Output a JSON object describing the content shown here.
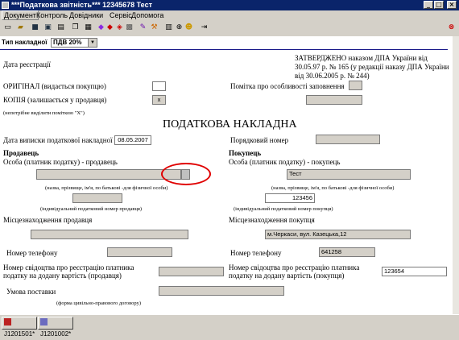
{
  "window": {
    "title": "***Податкова звітність*** 12345678 Тест"
  },
  "menu": [
    "Документ",
    "Контроль",
    "Довідники",
    "Сервіс",
    "Допомога"
  ],
  "toolbar": [
    "new-icon",
    "open-icon",
    "save-icon",
    "save-as-icon",
    "print-icon",
    "copy-icon",
    "paste-icon",
    "book-icon",
    "red-book-icon",
    "books-icon",
    "print-preview-icon",
    "edit-icon",
    "tools-icon",
    "layout-icon",
    "zoom-icon",
    "help-icon",
    "exit-icon",
    "close-icon"
  ],
  "form": {
    "type_label": "Тип накладної",
    "type_value": "ПДВ 20%",
    "approved": [
      "ЗАТВЕРДЖЕНО наказом ДПА України від",
      "30.05.97 р. № 165 (у редакції наказу ДПА України",
      "від 30.06.2005 р. № 244)"
    ],
    "reg_date_label": "Дата реєстрації",
    "original_label": "ОРИГІНАЛ (видається покупцю)",
    "copy_label": "КОПІЯ (залишається у продавця)",
    "copy_value": "x",
    "mark_note": "(непотрібне виділити поміткою \"Х\")",
    "special_label": "Помітка про особливості заповнення",
    "heading": "ПОДАТКОВА НАКЛАДНА",
    "issue_date_label": "Дата виписки податкової накладної",
    "issue_date": "08.05.2007",
    "seq_number_label": "Порядковий номер",
    "seller": {
      "heading": "Продавець",
      "person_label": "Особа (платник податку) - продавець",
      "name_hint": "(назва, прізвище, ім'я, по батькові -для фізичної особи)",
      "ipn_hint": "(індивідуальний податковий номер продавця)",
      "location_label": "Місцезнаходження продавця",
      "phone_label": "Номер телефону",
      "cert_label": [
        "Номер свідоцтва про реєстрацію платника",
        "податку на додану вартість (продавця)"
      ],
      "terms_label": "Умова поставки",
      "terms_hint": "(форма цивільно-правового договору)"
    },
    "buyer": {
      "heading": "Покупець",
      "person_label": "Особа (платник податку) - покупець",
      "name_value": "Тест",
      "name_hint": "(назва, прізвище, ім'я, по батькові -для фізичної особи)",
      "ipn_value": "123456",
      "ipn_hint": "(індивідуальний податковий номер покупця)",
      "location_label": "Місцезнаходження покупця",
      "location_value": "м.Черкаси, вул. Казецька,12",
      "phone_label": "Номер телефону",
      "phone_value": "641258",
      "cert_label": [
        "Номер свідоцтва про реєстрацію платника",
        "податку на додану вартість (покупця)"
      ],
      "cert_value": "123654"
    }
  },
  "taskbar": [
    "J1201501*",
    "J1201002*"
  ],
  "colors": {
    "title_bg": "#0a246a",
    "chrome": "#d4d0c8",
    "highlight": "#e00000"
  }
}
